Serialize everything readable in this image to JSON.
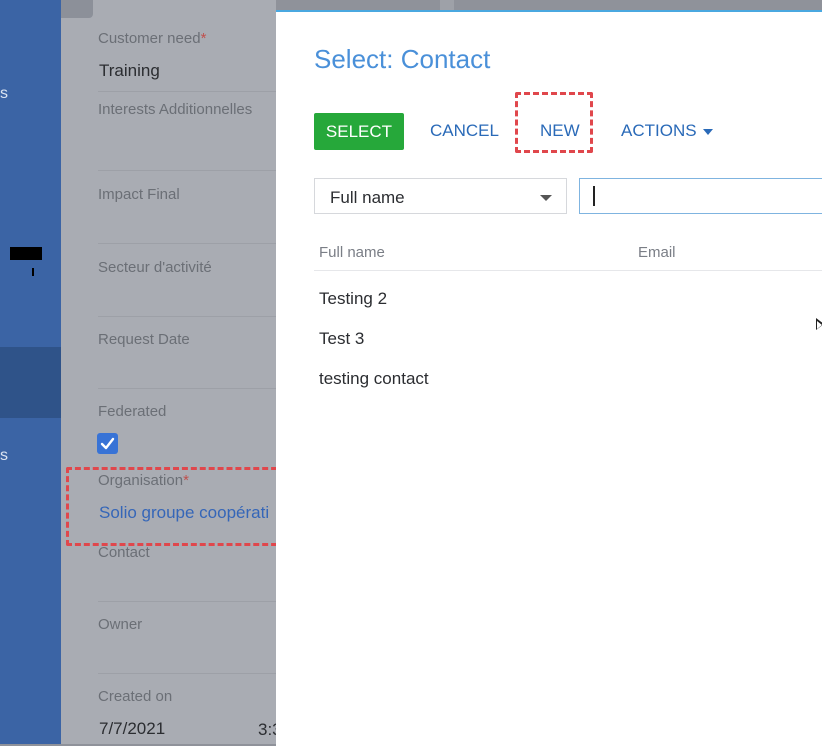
{
  "sidebar": {
    "fragment_1": "s",
    "fragment_2": "s"
  },
  "form": {
    "fields": [
      {
        "label": "Customer need",
        "required_mark": "*",
        "value": "Training"
      },
      {
        "label": "Interests Additionnelles",
        "value": ""
      },
      {
        "label": "Impact Final",
        "value": ""
      },
      {
        "label": "Secteur d'activité",
        "value": ""
      },
      {
        "label": "Request Date",
        "value": ""
      },
      {
        "label": "Federated",
        "checked": true
      },
      {
        "label": "Organisation",
        "required_mark": "*",
        "value": "Solio groupe coopérati"
      },
      {
        "label": "Contact",
        "value": ""
      },
      {
        "label": "Owner",
        "value": ""
      },
      {
        "label": "Created on",
        "value": "7/7/2021",
        "time_fragment": "3:3"
      }
    ],
    "checkbox_glyph": "✓"
  },
  "modal": {
    "title": "Select: Contact",
    "buttons": {
      "select": "SELECT",
      "cancel": "CANCEL",
      "new": "NEW",
      "actions": "ACTIONS"
    },
    "filter": {
      "selected": "Full name",
      "search_value": ""
    },
    "columns": [
      "Full name",
      "Email"
    ],
    "rows": [
      {
        "full_name": "Testing 2",
        "email": ""
      },
      {
        "full_name": "Test 3",
        "email": ""
      },
      {
        "full_name": "testing contact",
        "email": ""
      }
    ]
  },
  "colors": {
    "sidebar": "#3b64a5",
    "select_button": "#26a83a",
    "link": "#2a6ab8",
    "title": "#4a90d9",
    "highlight_dash": "#e0474c"
  }
}
